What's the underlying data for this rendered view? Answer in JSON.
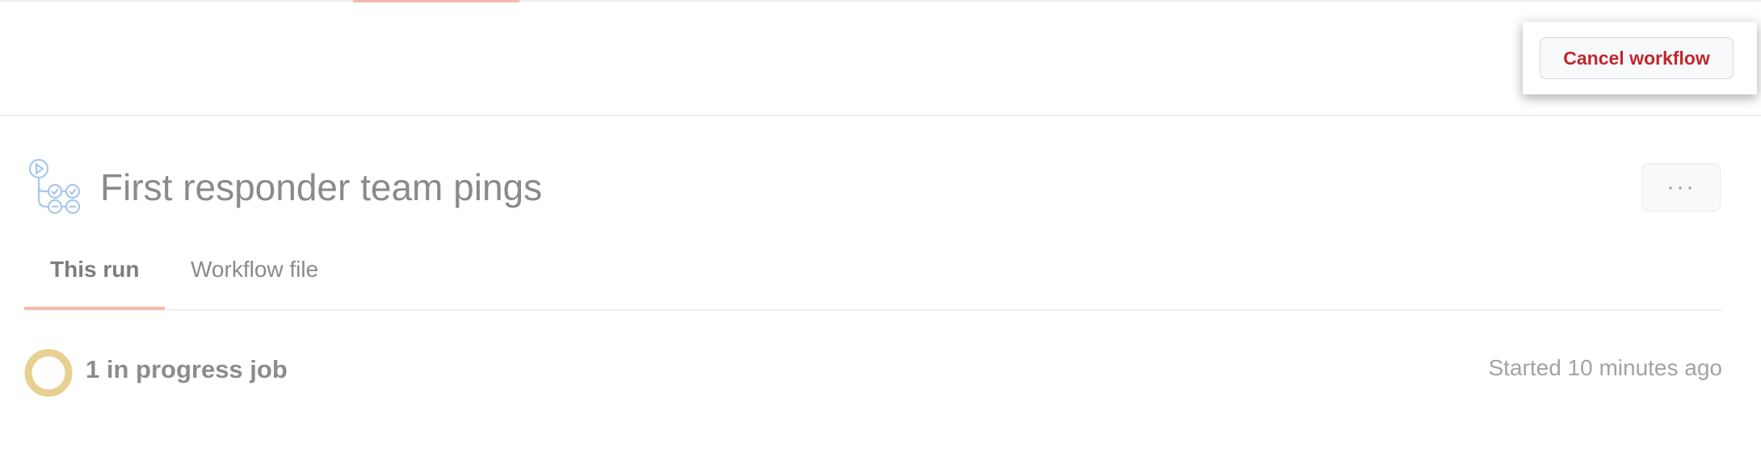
{
  "header": {
    "cancel_label": "Cancel workflow",
    "more_label": "···"
  },
  "workflow": {
    "title": "First responder team pings",
    "icon": "workflow-icon"
  },
  "tabs": [
    {
      "label": "This run",
      "active": true
    },
    {
      "label": "Workflow file",
      "active": false
    }
  ],
  "status": {
    "text": "1 in progress job",
    "started": "Started 10 minutes ago",
    "icon": "in-progress-icon"
  },
  "colors": {
    "cancel_text": "#c0272d",
    "accent_underline": "#f3b9aa",
    "in_progress": "#e8cf92",
    "workflow_icon": "#a9c7ee"
  }
}
